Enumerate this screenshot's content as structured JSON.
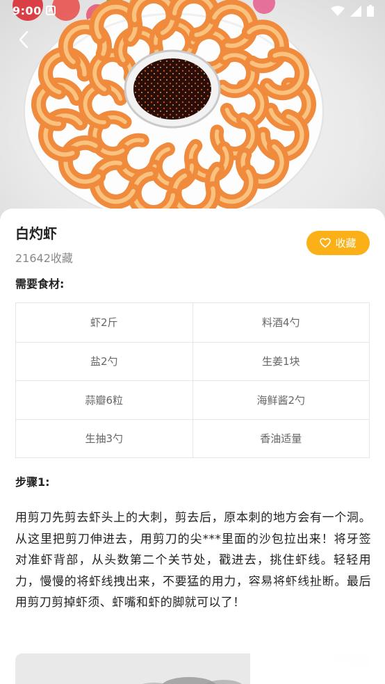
{
  "status_bar": {
    "time": "9:00",
    "app_badge": "A"
  },
  "recipe": {
    "title": "白灼虾",
    "favorites_count": "21642收藏",
    "favorite_button_label": "收藏",
    "ingredients_label": "需要食材:",
    "ingredients": [
      [
        "虾2斤",
        "料酒4勺"
      ],
      [
        "盐2勺",
        "生姜1块"
      ],
      [
        "蒜瓣6粒",
        "海鲜酱2勺"
      ],
      [
        "生抽3勺",
        "香油适量"
      ]
    ],
    "steps": [
      {
        "label": "步骤1:",
        "text": "用剪刀先剪去虾头上的大刺，剪去后，原本刺的地方会有一个洞。从这里把剪刀伸进去，用剪刀的尖***里面的沙包拉出来！将牙签对准虾背部，从头数第二个关节处，戳进去，挑住虾线。轻轻用力，慢慢的将虾线拽出来，不要猛的用力，容易将虾线扯断。最后用剪刀剪掉虾须、虾嘴和虾的脚就可以了！"
      }
    ]
  },
  "icons": {
    "back": "chevron-left-icon",
    "heart": "heart-outline-icon",
    "wifi": "wifi-icon",
    "signal": "signal-icon",
    "battery": "battery-icon"
  },
  "colors": {
    "accent": "#fbb018",
    "text_primary": "#222222",
    "text_secondary": "#888888",
    "border": "#e6e6e6"
  }
}
